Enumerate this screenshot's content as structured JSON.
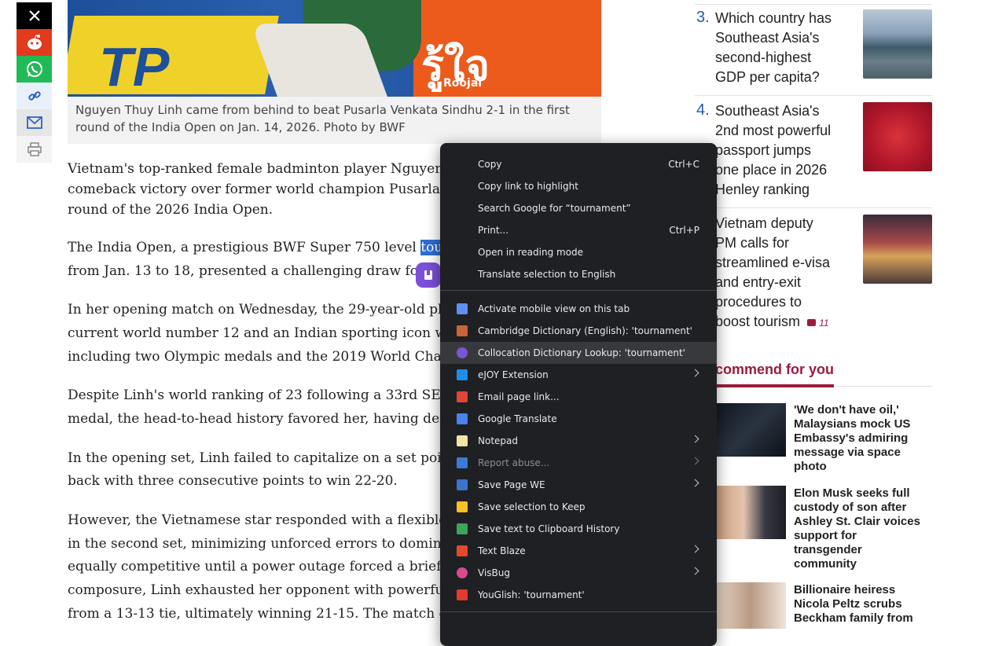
{
  "share": {
    "icons": [
      "x-icon",
      "reddit-icon",
      "whatsapp-icon",
      "link-icon",
      "email-icon",
      "print-icon"
    ]
  },
  "hero": {
    "sign_text": "รู้ใจ",
    "sign_sub": "Roojai",
    "caption_line1": "Nguyen Thuy Linh came from behind to beat Pusarla Venkata Sindhu 2-1 in the first",
    "caption_line2": "round of the India Open on Jan. 14, 2026. Photo by BWF"
  },
  "article": {
    "p1": [
      "Vietnam's top-ranked female badminton player Nguyen Thu",
      "comeback victory over former world champion Pusarla Venk",
      "round of the 2026 India Open."
    ],
    "p2_line1_pre": "The India Open, a prestigious BWF Super 750 level ",
    "p2_selected": "tournam",
    "p2_line2": "from Jan. 13 to 18, presented a challenging draw for the",
    "p3": [
      "In her opening match on Wednesday, the 29-year-old player",
      "current world number 12 and an Indian sporting icon with a",
      "including two Olympic medals and the 2019 World Champic"
    ],
    "p4": [
      "Despite Linh's world ranking of 23 following a 33rd SEA Ga",
      "medal, the head-to-head history favored her, having defeate"
    ],
    "p5": [
      "In the opening set, Linh failed to capitalize on a set point, al",
      "back with three consecutive points to win 22-20."
    ],
    "p6": [
      "However, the Vietnamese star responded with a flexible and",
      "in the second set, minimizing unforced errors to dominate 2",
      "equally competitive until a power outage forced a brief pause",
      "composure, Linh exhausted her opponent with powerful, pre",
      "from a 13-13 tie, ultimately winning 21-15. The match ended"
    ]
  },
  "rail": {
    "items": [
      {
        "num": "3.",
        "lines": [
          "Which country has",
          "Southeast Asia's",
          "second-highest",
          "GDP per capita?"
        ]
      },
      {
        "num": "4.",
        "lines": [
          "Southeast Asia's",
          "2nd most powerful",
          "passport jumps",
          "one place in 2026",
          "Henley ranking"
        ]
      },
      {
        "num": "",
        "lines": [
          "Vietnam deputy",
          "PM calls for",
          "streamlined e-visa",
          "and entry-exit",
          "procedures to",
          "boost tourism"
        ],
        "comments": "11"
      }
    ],
    "recommend_heading": "commend for you",
    "recommend": [
      {
        "lines": [
          "'We don't have oil,'",
          "Malaysians mock US",
          "Embassy's admiring",
          "message via space",
          "photo"
        ]
      },
      {
        "lines": [
          "Elon Musk seeks full",
          "custody of son after",
          "Ashley St. Clair voices",
          "support for",
          "transgender",
          "community"
        ]
      },
      {
        "lines": [
          "Billionaire heiress",
          "Nicola Peltz scrubs",
          "Beckham family from"
        ]
      }
    ]
  },
  "context_menu": {
    "group1": [
      {
        "label": "Copy",
        "shortcut": "Ctrl+C"
      },
      {
        "label": "Copy link to highlight",
        "shortcut": ""
      },
      {
        "label": "Search Google for “tournament”",
        "shortcut": ""
      },
      {
        "label": "Print...",
        "shortcut": "Ctrl+P"
      },
      {
        "label": "Open in reading mode",
        "shortcut": ""
      },
      {
        "label": "Translate selection to English",
        "shortcut": ""
      }
    ],
    "group2": [
      {
        "label": "Activate mobile view on this tab",
        "icon": "mobile-view-icon",
        "color": "#5f8ff0",
        "submenu": false
      },
      {
        "label": "Cambridge Dictionary (English): 'tournament'",
        "icon": "cambridge-dictionary-icon",
        "color": "#c7653a",
        "submenu": false
      },
      {
        "label": "Collocation Dictionary Lookup: 'tournament'",
        "icon": "collocation-dictionary-icon",
        "color": "#7a55d6",
        "submenu": false,
        "highlighted": true
      },
      {
        "label": "eJOY Extension",
        "icon": "ejoy-icon",
        "color": "#1e8ee8",
        "submenu": true
      },
      {
        "label": "Email page link...",
        "icon": "gmail-icon",
        "color": "#e0453a",
        "submenu": false
      },
      {
        "label": "Google Translate",
        "icon": "google-translate-icon",
        "color": "#4a82ee",
        "submenu": false
      },
      {
        "label": "Notepad",
        "icon": "notepad-icon",
        "color": "#efe6a5",
        "submenu": true
      },
      {
        "label": "Report abuse...",
        "icon": "report-abuse-icon",
        "color": "#3c7ad8",
        "submenu": true,
        "disabled": true
      },
      {
        "label": "Save Page WE",
        "icon": "save-page-we-icon",
        "color": "#3c74c9",
        "submenu": true
      },
      {
        "label": "Save selection to Keep",
        "icon": "google-keep-icon",
        "color": "#f6c026",
        "submenu": false
      },
      {
        "label": "Save text to Clipboard History",
        "icon": "clipboard-history-icon",
        "color": "#3aa55b",
        "submenu": false
      },
      {
        "label": "Text Blaze",
        "icon": "text-blaze-icon",
        "color": "#e4492d",
        "submenu": true
      },
      {
        "label": "VisBug",
        "icon": "visbug-icon",
        "color": "#d84a8a",
        "submenu": true
      },
      {
        "label": "YouGlish: 'tournament'",
        "icon": "youglish-icon",
        "color": "#e23a2e",
        "submenu": false
      }
    ]
  }
}
